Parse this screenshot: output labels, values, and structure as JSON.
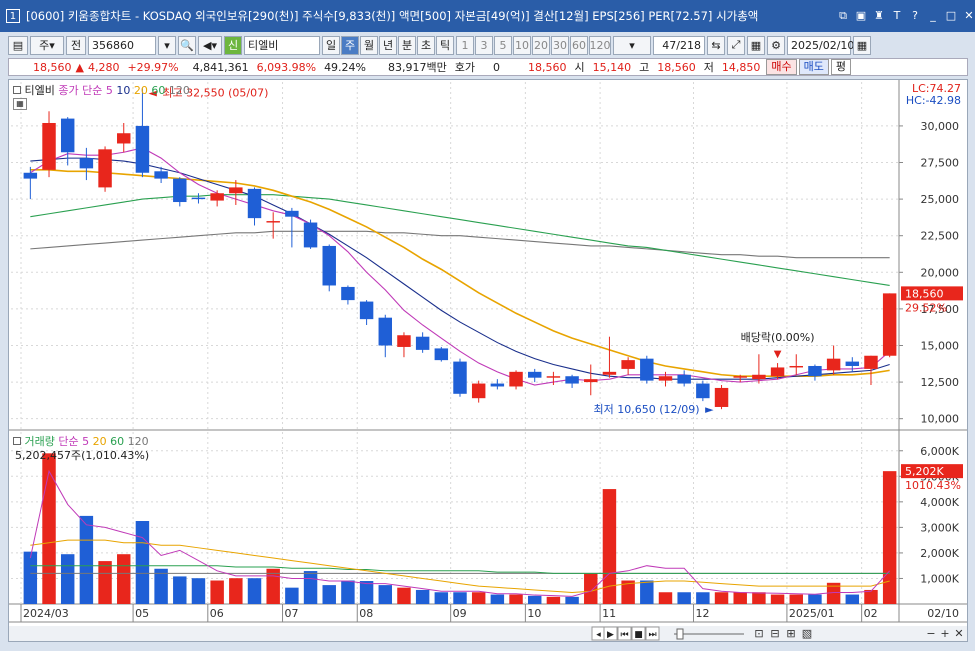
{
  "window": {
    "id": "1",
    "title": "[0600] 키움종합차트 - KOSDAQ 외국인보유[290(천)] 주식수[9,833(천)] 액면[500] 자본금[49(억)] 결산[12월] EPS[256] PER[72.57] 시가총액"
  },
  "toolbar": {
    "period": "주",
    "jeon": "전",
    "code": "356860",
    "stock_badge": "신",
    "stock_name": "티엘비",
    "tabs": [
      "일",
      "주",
      "월",
      "년",
      "분",
      "초",
      "틱"
    ],
    "selected_tab": "주",
    "intervals": [
      "1",
      "3",
      "5",
      "10",
      "20",
      "30",
      "60",
      "120"
    ],
    "count": "47",
    "count_total": "/218",
    "date": "2025/02/10"
  },
  "quote": {
    "price": "18,560",
    "change": "4,280",
    "pct": "+29.97%",
    "volume": "4,841,361",
    "vol_ratio": "6,093.98%",
    "turnover": "49.24%",
    "amount": "83,917백만",
    "hoga_label": "호가",
    "hoga": "0",
    "hoga_price": "18,560",
    "open_label": "시",
    "open": "15,140",
    "high_label": "고",
    "high": "18,560",
    "low_label": "저",
    "low": "14,850",
    "buy": "매수",
    "sell": "매도",
    "eval": "평"
  },
  "price_panel": {
    "legend_name": "티엘비",
    "legend_ma_label": "종가 단순",
    "legend_ma": [
      "5",
      "10",
      "20",
      "60",
      "120"
    ],
    "lc": "LC:74.27",
    "hc": "HC:-42.98",
    "max_label": "최고 32,550 (05/07)",
    "min_label": "최저 10,650 (12/09)",
    "dividend_label": "배당락(0.00%)",
    "last_price_tag": "18,560",
    "last_pct_tag": "29.52%",
    "y_ticks": [
      "30,000",
      "27,500",
      "25,000",
      "22,500",
      "20,000",
      "17,500",
      "15,000",
      "12,500",
      "10,000"
    ]
  },
  "volume_panel": {
    "legend_name": "거래량",
    "legend_ma_label": "단순",
    "legend_ma": [
      "5",
      "20",
      "60",
      "120"
    ],
    "value_text": "5,202,457주(1,010.43%)",
    "last_vol_tag": "5,202K",
    "last_pct_tag": "1010.43%",
    "y_ticks": [
      "6,000K",
      "5,000K",
      "4,000K",
      "3,000K",
      "2,000K",
      "1,000K"
    ]
  },
  "x_axis": {
    "labels": [
      "2024/03",
      "05",
      "06",
      "07",
      "08",
      "09",
      "10",
      "11",
      "12",
      "2025/01",
      "02"
    ],
    "right_label": "02/10"
  },
  "colors": {
    "up": "#e8261c",
    "down": "#1f5fd6",
    "ma5": "#c03ab8",
    "ma10": "#1a2f8c",
    "ma20": "#e8a400",
    "ma60": "#2aa050",
    "ma120": "#777777"
  },
  "chart_data": {
    "type": "candlestick",
    "candles": [
      {
        "o": 26800,
        "h": 27200,
        "l": 25000,
        "c": 26400
      },
      {
        "o": 27000,
        "h": 31000,
        "l": 26500,
        "c": 30200
      },
      {
        "o": 30500,
        "h": 30600,
        "l": 27300,
        "c": 28200
      },
      {
        "o": 27800,
        "h": 28500,
        "l": 26300,
        "c": 27100
      },
      {
        "o": 25800,
        "h": 28600,
        "l": 25500,
        "c": 28400
      },
      {
        "o": 28800,
        "h": 30200,
        "l": 28200,
        "c": 29500
      },
      {
        "o": 30000,
        "h": 32550,
        "l": 26500,
        "c": 26800
      },
      {
        "o": 26900,
        "h": 27200,
        "l": 26100,
        "c": 26400
      },
      {
        "o": 26400,
        "h": 26500,
        "l": 24500,
        "c": 24800
      },
      {
        "o": 25100,
        "h": 25400,
        "l": 24700,
        "c": 25000
      },
      {
        "o": 24900,
        "h": 25600,
        "l": 24500,
        "c": 25400
      },
      {
        "o": 25400,
        "h": 26300,
        "l": 24600,
        "c": 25800
      },
      {
        "o": 25700,
        "h": 25800,
        "l": 23200,
        "c": 23700
      },
      {
        "o": 23400,
        "h": 24100,
        "l": 22300,
        "c": 23500
      },
      {
        "o": 24200,
        "h": 24400,
        "l": 21700,
        "c": 23800
      },
      {
        "o": 23400,
        "h": 23600,
        "l": 21600,
        "c": 21700
      },
      {
        "o": 21800,
        "h": 21900,
        "l": 18700,
        "c": 19100
      },
      {
        "o": 19000,
        "h": 19100,
        "l": 17800,
        "c": 18100
      },
      {
        "o": 18000,
        "h": 18100,
        "l": 16400,
        "c": 16800
      },
      {
        "o": 16900,
        "h": 17100,
        "l": 14200,
        "c": 15000
      },
      {
        "o": 14900,
        "h": 15900,
        "l": 14200,
        "c": 15700
      },
      {
        "o": 15600,
        "h": 15900,
        "l": 14500,
        "c": 14700
      },
      {
        "o": 14800,
        "h": 14900,
        "l": 13900,
        "c": 14000
      },
      {
        "o": 13900,
        "h": 14100,
        "l": 11500,
        "c": 11700
      },
      {
        "o": 11400,
        "h": 12600,
        "l": 11100,
        "c": 12400
      },
      {
        "o": 12400,
        "h": 12700,
        "l": 12000,
        "c": 12200
      },
      {
        "o": 12200,
        "h": 13300,
        "l": 12000,
        "c": 13200
      },
      {
        "o": 13200,
        "h": 13400,
        "l": 12500,
        "c": 12800
      },
      {
        "o": 12800,
        "h": 13200,
        "l": 12300,
        "c": 12900
      },
      {
        "o": 12900,
        "h": 13000,
        "l": 12100,
        "c": 12400
      },
      {
        "o": 12500,
        "h": 13700,
        "l": 11600,
        "c": 12700
      },
      {
        "o": 13000,
        "h": 15600,
        "l": 12800,
        "c": 13200
      },
      {
        "o": 13400,
        "h": 14200,
        "l": 13000,
        "c": 14000
      },
      {
        "o": 14100,
        "h": 14300,
        "l": 12400,
        "c": 12600
      },
      {
        "o": 12600,
        "h": 13200,
        "l": 12200,
        "c": 12900
      },
      {
        "o": 13000,
        "h": 13300,
        "l": 12200,
        "c": 12400
      },
      {
        "o": 12400,
        "h": 12600,
        "l": 11200,
        "c": 11400
      },
      {
        "o": 10800,
        "h": 12300,
        "l": 10650,
        "c": 12100
      },
      {
        "o": 12800,
        "h": 13000,
        "l": 12500,
        "c": 12900
      },
      {
        "o": 12700,
        "h": 14400,
        "l": 12400,
        "c": 13000
      },
      {
        "o": 12900,
        "h": 13800,
        "l": 12700,
        "c": 13500
      },
      {
        "o": 13500,
        "h": 14400,
        "l": 13000,
        "c": 13600
      },
      {
        "o": 13600,
        "h": 13700,
        "l": 12600,
        "c": 12900
      },
      {
        "o": 13300,
        "h": 15000,
        "l": 13000,
        "c": 14100
      },
      {
        "o": 13900,
        "h": 14200,
        "l": 13200,
        "c": 13600
      },
      {
        "o": 13400,
        "h": 14300,
        "l": 12300,
        "c": 14300
      },
      {
        "o": 14300,
        "h": 18560,
        "l": 14200,
        "c": 18560
      }
    ],
    "volumes": [
      2050,
      5900,
      1950,
      3450,
      1680,
      1950,
      3250,
      1380,
      1080,
      1010,
      920,
      1010,
      1010,
      1380,
      640,
      1290,
      740,
      920,
      900,
      740,
      640,
      550,
      460,
      460,
      460,
      370,
      370,
      320,
      280,
      280,
      1200,
      4500,
      920,
      920,
      460,
      460,
      460,
      460,
      460,
      460,
      370,
      370,
      370,
      830,
      370,
      550,
      5202
    ],
    "ma": {
      "ma5": [
        26800,
        27600,
        28100,
        28000,
        28000,
        28200,
        28500,
        27800,
        26800,
        26000,
        25400,
        25000,
        24600,
        24200,
        23900,
        23300,
        22500,
        21400,
        20000,
        18800,
        17400,
        16400,
        15500,
        14600,
        13800,
        13200,
        12700,
        12300,
        12500,
        12700,
        12600,
        12700,
        13000,
        13000,
        13000,
        13000,
        12800,
        12600,
        12500,
        12600,
        12700,
        13000,
        13300,
        13400,
        13400,
        13500,
        14600
      ],
      "ma10": [
        27600,
        27700,
        27800,
        27800,
        27700,
        27600,
        27400,
        27100,
        26800,
        26400,
        26000,
        25600,
        25200,
        24600,
        24000,
        23300,
        22600,
        21800,
        21000,
        20100,
        19200,
        18300,
        17400,
        16600,
        15900,
        15200,
        14600,
        14100,
        13700,
        13400,
        13100,
        12900,
        12800,
        12800,
        12700,
        12700,
        12700,
        12700,
        12700,
        12700,
        12800,
        12900,
        13000,
        13100,
        13200,
        13300,
        13700
      ],
      "ma20": [
        27000,
        27000,
        26900,
        26900,
        26800,
        26700,
        26600,
        26500,
        26400,
        26300,
        26200,
        26100,
        25900,
        25600,
        25200,
        24800,
        24300,
        23700,
        23100,
        22400,
        21700,
        20900,
        20200,
        19400,
        18600,
        17900,
        17200,
        16600,
        16000,
        15500,
        15100,
        14700,
        14300,
        13900,
        13600,
        13400,
        13200,
        13000,
        12900,
        12900,
        12900,
        12900,
        12900,
        13000,
        13000,
        13100,
        13300
      ],
      "ma60": [
        23800,
        24000,
        24200,
        24400,
        24600,
        24800,
        25000,
        25100,
        25200,
        25200,
        25300,
        25300,
        25300,
        25300,
        25200,
        25100,
        25000,
        24800,
        24600,
        24400,
        24200,
        24000,
        23800,
        23600,
        23400,
        23200,
        23000,
        22800,
        22600,
        22400,
        22200,
        22000,
        21800,
        21700,
        21500,
        21300,
        21100,
        20900,
        20700,
        20500,
        20300,
        20100,
        19900,
        19700,
        19500,
        19300,
        19100
      ],
      "ma120": [
        21600,
        21700,
        21800,
        21900,
        22000,
        22100,
        22200,
        22300,
        22400,
        22500,
        22600,
        22700,
        22700,
        22800,
        22800,
        22800,
        22800,
        22800,
        22800,
        22700,
        22700,
        22600,
        22500,
        22500,
        22400,
        22300,
        22200,
        22100,
        22000,
        21900,
        21800,
        21800,
        21700,
        21600,
        21500,
        21400,
        21300,
        21200,
        21200,
        21100,
        21100,
        21000,
        21000,
        21000,
        21000,
        21000,
        21000
      ]
    },
    "vol_ma": {
      "ma5": [
        1800,
        5200,
        3900,
        3100,
        3000,
        2800,
        2600,
        1900,
        2100,
        1700,
        1300,
        1100,
        1100,
        1100,
        1000,
        1000,
        900,
        900,
        800,
        800,
        700,
        600,
        500,
        500,
        500,
        400,
        400,
        350,
        330,
        300,
        500,
        1200,
        1300,
        1500,
        1400,
        1400,
        600,
        500,
        450,
        430,
        420,
        400,
        380,
        450,
        450,
        500,
        1300
      ],
      "ma20": [
        2300,
        2400,
        2500,
        2500,
        2500,
        2400,
        2400,
        2300,
        2300,
        2200,
        2100,
        2000,
        1900,
        1800,
        1700,
        1600,
        1500,
        1400,
        1300,
        1200,
        1100,
        1000,
        900,
        800,
        700,
        650,
        600,
        550,
        500,
        450,
        500,
        700,
        800,
        850,
        900,
        900,
        850,
        800,
        750,
        700,
        700,
        700,
        700,
        700,
        700,
        700,
        900
      ],
      "ma60": [
        1500,
        1500,
        1500,
        1500,
        1500,
        1500,
        1500,
        1500,
        1500,
        1500,
        1500,
        1450,
        1450,
        1450,
        1400,
        1400,
        1400,
        1350,
        1350,
        1300,
        1300,
        1300,
        1300,
        1300,
        1300,
        1250,
        1250,
        1250,
        1200,
        1200,
        1200,
        1200,
        1200,
        1200,
        1200,
        1200,
        1200,
        1200,
        1200,
        1200,
        1200,
        1200,
        1200,
        1200,
        1200,
        1200,
        1200
      ],
      "ma120": [
        1200,
        1200,
        1200,
        1200,
        1200,
        1200,
        1200,
        1200,
        1200,
        1200,
        1200,
        1200,
        1200,
        1200,
        1200,
        1200,
        1200,
        1200,
        1200,
        1200,
        1200,
        1200,
        1200,
        1200,
        1200,
        1200,
        1200,
        1200,
        1200,
        1200,
        1200,
        1200,
        1200,
        1200,
        1200,
        1200,
        1200,
        1200,
        1200,
        1200,
        1200,
        1200,
        1200,
        1200,
        1200,
        1200,
        1200
      ]
    },
    "price_ylim": [
      9500,
      33000
    ],
    "volume_ylim": [
      0,
      6500
    ],
    "x_label_index": [
      0,
      6,
      10,
      14,
      18,
      23,
      27,
      31,
      36,
      41,
      45
    ]
  }
}
